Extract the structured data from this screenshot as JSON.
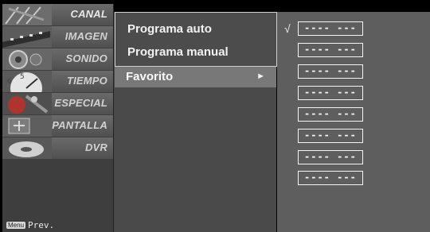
{
  "left_menu": {
    "items": [
      {
        "label": "CANAL",
        "icon": "channel-antenna-icon"
      },
      {
        "label": "IMAGEN",
        "icon": "picture-film-icon"
      },
      {
        "label": "SONIDO",
        "icon": "speaker-icon"
      },
      {
        "label": "TIEMPO",
        "icon": "clock-icon"
      },
      {
        "label": "ESPECIAL",
        "icon": "special-icon"
      },
      {
        "label": "PANTALLA",
        "icon": "screen-icon"
      },
      {
        "label": "DVR",
        "icon": "dvr-disc-icon"
      }
    ],
    "footer": {
      "key": "Menu",
      "text": "Prev."
    }
  },
  "submenu": {
    "items": [
      "Programa auto",
      "Programa manual",
      "Favorito"
    ],
    "selected": "Favorito",
    "arrow": "►"
  },
  "favorites": {
    "check": "√",
    "slots": [
      "----  ---",
      "----  ---",
      "----  ---",
      "----  ---",
      "----  ---",
      "----  ---",
      "----  ---",
      "----  ---"
    ]
  }
}
